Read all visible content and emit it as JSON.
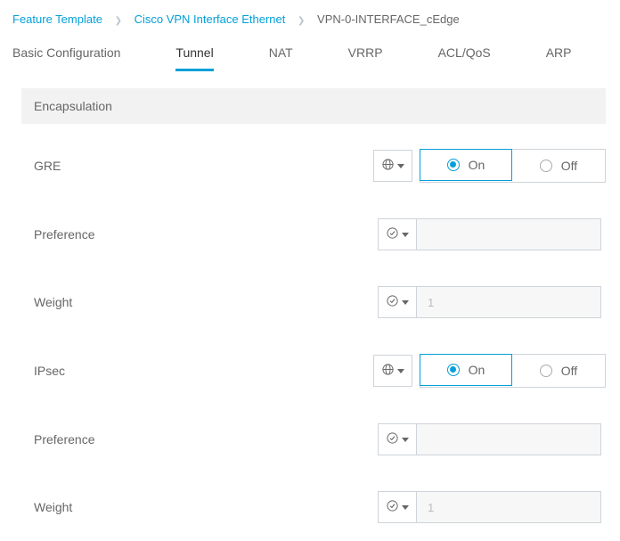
{
  "breadcrumb": {
    "items": [
      "Feature Template",
      "Cisco VPN Interface Ethernet",
      "VPN-0-INTERFACE_cEdge"
    ]
  },
  "tabs": [
    {
      "label": "Basic Configuration",
      "active": false
    },
    {
      "label": "Tunnel",
      "active": true
    },
    {
      "label": "NAT",
      "active": false
    },
    {
      "label": "VRRP",
      "active": false
    },
    {
      "label": "ACL/QoS",
      "active": false
    },
    {
      "label": "ARP",
      "active": false
    }
  ],
  "section": {
    "title": "Encapsulation"
  },
  "onoff": {
    "on": "On",
    "off": "Off"
  },
  "fields": {
    "gre": {
      "label": "GRE",
      "type": "radio",
      "icon": "globe",
      "value": "On"
    },
    "pref1": {
      "label": "Preference",
      "type": "text",
      "icon": "check",
      "value": "",
      "placeholder": ""
    },
    "weight1": {
      "label": "Weight",
      "type": "text",
      "icon": "check",
      "value": "",
      "placeholder": "1"
    },
    "ipsec": {
      "label": "IPsec",
      "type": "radio",
      "icon": "globe",
      "value": "On"
    },
    "pref2": {
      "label": "Preference",
      "type": "text",
      "icon": "check",
      "value": "",
      "placeholder": ""
    },
    "weight2": {
      "label": "Weight",
      "type": "text",
      "icon": "check",
      "value": "",
      "placeholder": "1"
    }
  }
}
